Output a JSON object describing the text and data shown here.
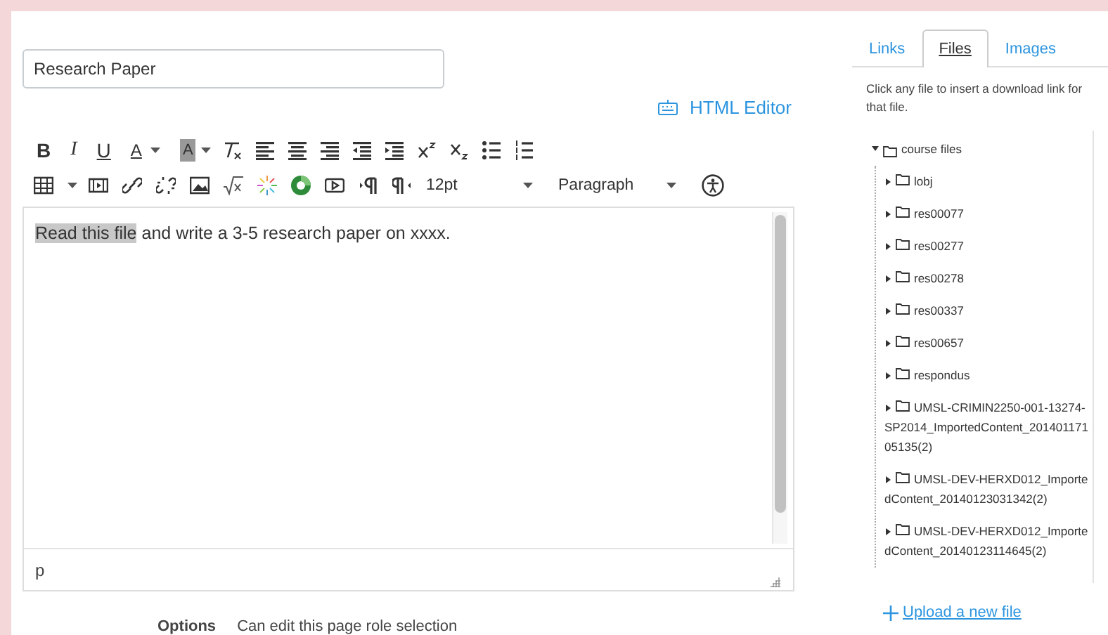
{
  "title_field": {
    "value": "Research Paper"
  },
  "html_editor_link": "HTML Editor",
  "toolbar": [
    [
      {
        "kind": "bold",
        "text": "B"
      },
      {
        "kind": "italic",
        "text": "I"
      },
      {
        "kind": "underline",
        "text": "U"
      },
      {
        "kind": "color",
        "text": "A"
      },
      {
        "kind": "caret"
      },
      {
        "kind": "highlight",
        "text": "A"
      },
      {
        "kind": "caret"
      },
      {
        "kind": "icon"
      },
      {
        "kind": "icon"
      },
      {
        "kind": "icon"
      },
      {
        "kind": "icon"
      },
      {
        "kind": "icon"
      },
      {
        "kind": "icon"
      },
      {
        "kind": "icon"
      },
      {
        "kind": "icon"
      },
      {
        "kind": "icon"
      },
      {
        "kind": "icon"
      }
    ],
    [
      {
        "kind": "icon"
      },
      {
        "kind": "caret"
      },
      {
        "kind": "icon"
      },
      {
        "kind": "icon"
      },
      {
        "kind": "icon"
      },
      {
        "kind": "icon"
      },
      {
        "kind": "icon"
      },
      {
        "kind": "icon"
      },
      {
        "kind": "icon"
      },
      {
        "kind": "icon"
      },
      {
        "kind": "icon"
      },
      {
        "kind": "icon"
      },
      {
        "kind": "select",
        "text": "12pt"
      },
      {
        "kind": "select",
        "text": "Paragraph"
      },
      {
        "kind": "icon"
      }
    ]
  ],
  "editor": {
    "runs": [
      {
        "text": "Read this file",
        "highlighted": true
      },
      {
        "text": " and write a 3-5 research paper on xxxx.",
        "highlighted": false
      }
    ],
    "path": "p"
  },
  "options": {
    "label": "Options",
    "value": "Can edit this page role selection"
  },
  "sidebar": {
    "tabs": [
      {
        "label": "Links",
        "selected": false
      },
      {
        "label": "Files",
        "selected": true
      },
      {
        "label": "Images",
        "selected": false
      }
    ],
    "hint": "Click any file to insert a download link for that file.",
    "tree": [
      {
        "label": "course files",
        "expanded": true,
        "children": [
          {
            "label": "lobj",
            "expanded": false
          },
          {
            "label": "res00077",
            "expanded": false
          },
          {
            "label": "res00277",
            "expanded": false
          },
          {
            "label": "res00278",
            "expanded": false
          },
          {
            "label": "res00337",
            "expanded": false
          },
          {
            "label": "res00657",
            "expanded": false
          },
          {
            "label": "respondus",
            "expanded": false
          },
          {
            "label": "UMSL-CRIMIN2250-001-13274-SP2014_ImportedContent_20140117105135(2)",
            "expanded": false
          },
          {
            "label": "UMSL-DEV-HERXD012_ImportedContent_20140123031342(2)",
            "expanded": false
          },
          {
            "label": "UMSL-DEV-HERXD012_ImportedContent_20140123114645(2)",
            "expanded": false
          }
        ]
      }
    ],
    "upload_link": "Upload a new file"
  }
}
